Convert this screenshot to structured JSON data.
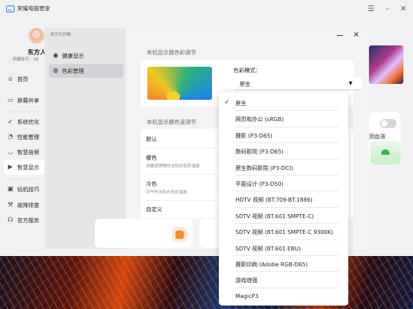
{
  "app": {
    "title": "荣耀电脑管家",
    "user_name": "东方人",
    "account_prefix": "荣耀账号：18"
  },
  "window_controls": {
    "menu": "☰",
    "minimize": "–",
    "close": "✕"
  },
  "sidebar": {
    "items": [
      {
        "label": "首页",
        "icon": "home-icon",
        "glyph": "⌂"
      },
      {
        "label": "屏幕共享",
        "icon": "screen-share-icon",
        "glyph": "▭"
      },
      {
        "label": "系统优化",
        "icon": "rocket-icon",
        "glyph": "➶"
      },
      {
        "label": "性能管理",
        "icon": "performance-icon",
        "glyph": "◔"
      },
      {
        "label": "智慧音频",
        "icon": "headphones-icon",
        "glyph": "◡"
      },
      {
        "label": "智慧显示",
        "icon": "display-icon",
        "glyph": "▶"
      },
      {
        "label": "玩机技巧",
        "icon": "tips-icon",
        "glyph": "▣"
      },
      {
        "label": "故障排查",
        "icon": "wrench-icon",
        "glyph": "⚒"
      },
      {
        "label": "官方服务",
        "icon": "service-icon",
        "glyph": "☊"
      }
    ]
  },
  "subpanel": {
    "crumb": "显示与护眼",
    "items": [
      {
        "label": "健康显示",
        "icon": "eye-icon",
        "glyph": "◉"
      },
      {
        "label": "色彩管理",
        "icon": "palette-icon",
        "glyph": "◍"
      }
    ]
  },
  "color_section": {
    "title": "本机显示器色彩调节",
    "mode_label": "色彩模式：",
    "mode_value": "原生"
  },
  "temp_section": {
    "title": "本机显示器色温调节",
    "rows": [
      {
        "title": "默认",
        "desc": ""
      },
      {
        "title": "暖色",
        "desc": "消藏或傍晚时太阳光色彩温度"
      },
      {
        "title": "冷色",
        "desc": "正午时太阳光色彩温度"
      },
      {
        "title": "自定义",
        "desc": ""
      }
    ]
  },
  "right_widget": {
    "label": "测血液"
  },
  "dropdown": {
    "selected_index": 0,
    "options": [
      "原生",
      "网页和办公 (sRGB)",
      "摄影 (P3-D65)",
      "数码影院 (P3-D65)",
      "原生数码影院 (P3-DCI)",
      "平面设计 (P3-D50)",
      "HDTV 视频 (BT.709-BT.1886)",
      "SDTV 视频 (BT.601 SMPTE-C)",
      "SDTV 视频 (BT.601 SMPTE-C 9300K)",
      "SDTV 视频 (BT.601 EBU)",
      "摄影印刷 (Adobe RGB-D65)",
      "游戏增强",
      "MagicP3"
    ]
  }
}
